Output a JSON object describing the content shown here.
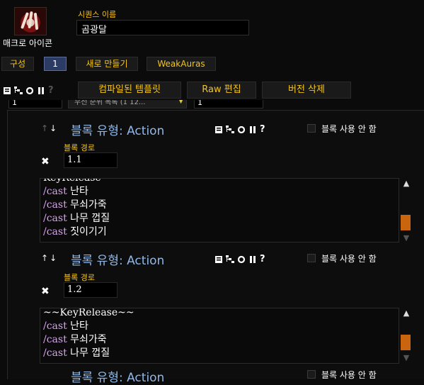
{
  "header": {
    "icon_caption": "매크로 아이콘",
    "icon_name": "macro-claw-icon",
    "sequence_label": "시퀀스 이름",
    "sequence_value": "곰광달"
  },
  "tabs": [
    {
      "label": "구성"
    },
    {
      "label": "1",
      "active": true
    },
    {
      "label": "새로 만들기"
    },
    {
      "label": "WeakAuras"
    }
  ],
  "toolbar": {
    "icons": [
      "document-icon",
      "tree-icon",
      "circle-icon",
      "pause-icon",
      "help-icon"
    ],
    "buttons": [
      {
        "label": "컴파일된 템플릿"
      },
      {
        "label": "Raw 편집"
      },
      {
        "label": "버전 삭제"
      }
    ]
  },
  "clipped_row": {
    "left_value": "1",
    "select_value": "우선 순위 목록 (1 12...",
    "right_value": "1"
  },
  "blocks": [
    {
      "type_label": "블록 유형: Action",
      "disable_label": "블록 사용 안 함",
      "path_label": "블록 경로",
      "path_value": "1.1",
      "lines": [
        {
          "kw": "",
          "text": "KeyRelease"
        },
        {
          "kw": "/cast",
          "text": "난타"
        },
        {
          "kw": "/cast",
          "text": "무쇠가죽"
        },
        {
          "kw": "/cast",
          "text": "나무 껍질"
        },
        {
          "kw": "/cast",
          "text": "짓이기기"
        }
      ]
    },
    {
      "type_label": "블록 유형: Action",
      "disable_label": "블록 사용 안 함",
      "path_label": "블록 경로",
      "path_value": "1.2",
      "lines": [
        {
          "kw": "",
          "text": "~~KeyRelease~~"
        },
        {
          "kw": "/cast",
          "text": "난타"
        },
        {
          "kw": "/cast",
          "text": "무쇠가죽"
        },
        {
          "kw": "/cast",
          "text": "나무 껍질"
        }
      ]
    },
    {
      "type_label": "블록 유형: Action",
      "disable_label": "블록 사용 안 함"
    }
  ],
  "colors": {
    "gold": "#f5c518",
    "blue": "#8fb8e8",
    "purple": "#d7a0f0",
    "scroll_thumb": "#c8650e",
    "active_tab": "#2c3b63"
  }
}
